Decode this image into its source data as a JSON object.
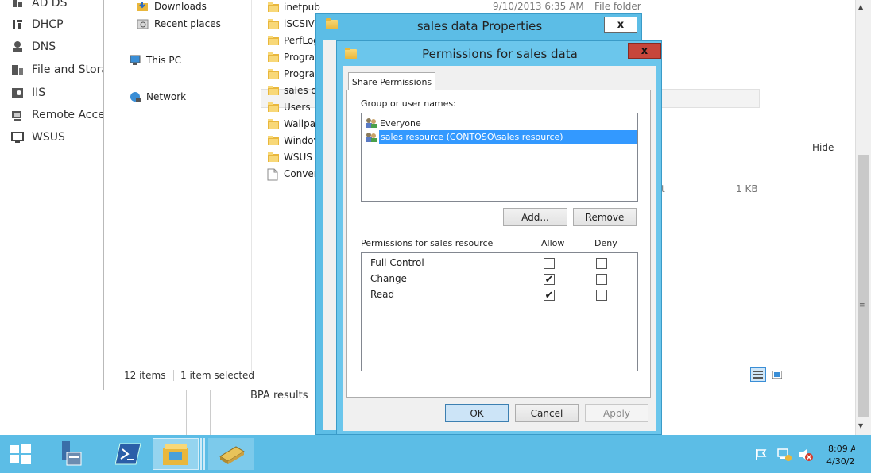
{
  "server_nav": {
    "items": [
      {
        "label": "AD DS",
        "icon": "ad-ds-icon"
      },
      {
        "label": "DHCP",
        "icon": "dhcp-icon"
      },
      {
        "label": "DNS",
        "icon": "dns-icon"
      },
      {
        "label": "File and Stora",
        "icon": "file-storage-icon"
      },
      {
        "label": "IIS",
        "icon": "iis-icon"
      },
      {
        "label": "Remote Acce",
        "icon": "remote-access-icon"
      },
      {
        "label": "WSUS",
        "icon": "wsus-icon"
      }
    ]
  },
  "explorer": {
    "tree": [
      {
        "label": "Downloads",
        "icon": "downloads-icon"
      },
      {
        "label": "Recent places",
        "icon": "recent-places-icon"
      },
      {
        "label": "This PC",
        "icon": "this-pc-icon"
      },
      {
        "label": "Network",
        "icon": "network-icon"
      }
    ],
    "files": [
      "inetpub",
      "iSCSIVi",
      "PerfLog",
      "Prograi",
      "Prograi",
      "sales da",
      "Users",
      "Wallpa",
      "Windov",
      "WSUS",
      "Conver"
    ],
    "row_date": "9/10/2013 6:35 AM",
    "row_type": "File folder",
    "size_frag": "t",
    "size": "1 KB",
    "status_items": "12 items",
    "status_selected": "1 item selected"
  },
  "server_manager": {
    "hide_label": "Hide",
    "bpa_label": "BPA results"
  },
  "properties_window": {
    "title": "sales data Properties",
    "close_label": "x"
  },
  "permissions_dialog": {
    "title": "Permissions for sales data",
    "close_label": "x",
    "tab": "Share Permissions",
    "group_label": "Group or user names:",
    "users": [
      {
        "name": "Everyone",
        "selected": false
      },
      {
        "name": "sales resource (CONTOSO\\sales resource)",
        "selected": true
      }
    ],
    "add_label": "Add...",
    "remove_label": "Remove",
    "perm_header": "Permissions for sales resource",
    "allow_header": "Allow",
    "deny_header": "Deny",
    "permissions": [
      {
        "name": "Full Control",
        "allow": false,
        "deny": false
      },
      {
        "name": "Change",
        "allow": true,
        "deny": false
      },
      {
        "name": "Read",
        "allow": true,
        "deny": false
      }
    ],
    "ok_label": "OK",
    "cancel_label": "Cancel",
    "apply_label": "Apply"
  },
  "taskbar": {
    "time": "8:09 A",
    "date": "4/30/2"
  }
}
